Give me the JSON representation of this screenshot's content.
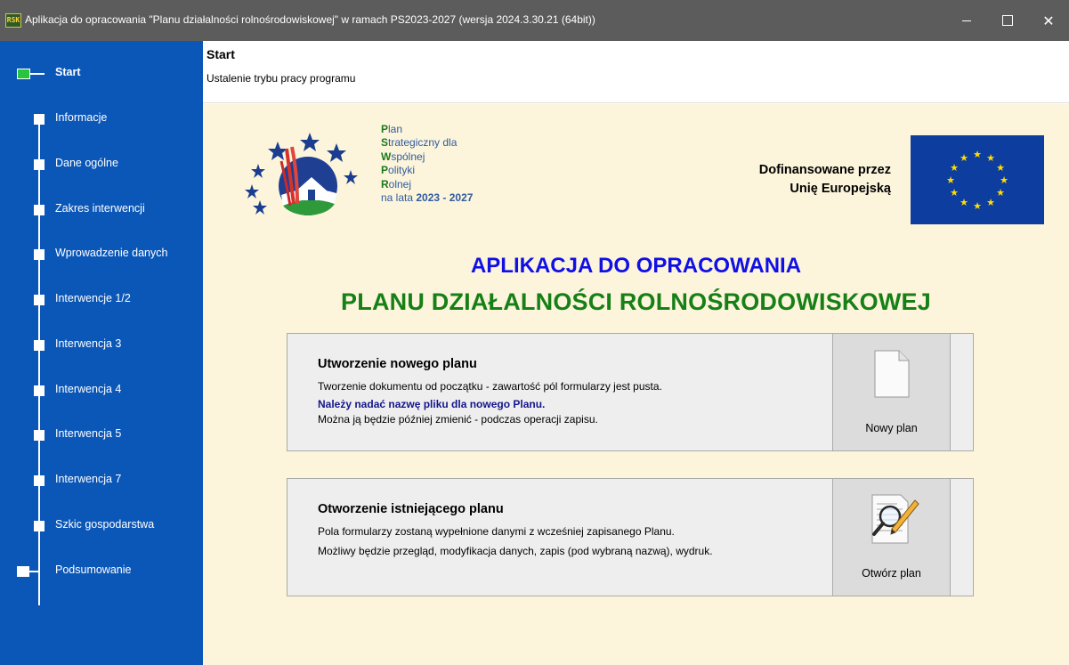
{
  "window": {
    "title": "Aplikacja do opracowania \"Planu działalności rolnośrodowiskowej\" w ramach PS2023-2027  (wersja 2024.3.30.21 (64bit))",
    "icon_text": "RSK",
    "close_glyph": "✕"
  },
  "sidebar": {
    "items": [
      {
        "label": "Start"
      },
      {
        "label": "Informacje"
      },
      {
        "label": "Dane ogólne"
      },
      {
        "label": "Zakres interwencji"
      },
      {
        "label": "Wprowadzenie danych"
      },
      {
        "label": "Interwencje 1/2"
      },
      {
        "label": "Interwencja 3"
      },
      {
        "label": "Interwencja 4"
      },
      {
        "label": "Interwencja 5"
      },
      {
        "label": "Interwencja 7"
      },
      {
        "label": "Szkic gospodarstwa"
      },
      {
        "label": "Podsumowanie"
      }
    ],
    "active_color": "#28c43c",
    "background": "#0b57b8"
  },
  "header": {
    "title": "Start",
    "subtitle": "Ustalenie trybu pracy programu"
  },
  "logo": {
    "line1_cap": "P",
    "line1_rest": "lan",
    "line2_cap": "S",
    "line2_rest": "trategiczny dla",
    "line3_cap": "W",
    "line3_rest": "spólnej",
    "line4_cap": "P",
    "line4_rest": "olityki",
    "line5_cap": "R",
    "line5_rest": "olnej",
    "line6_pre": "na lata ",
    "line6_years": "2023 - 2027"
  },
  "cofinancing": {
    "line1": "Dofinansowane przez",
    "line2": "Unię Europejską"
  },
  "main_title": {
    "line1": "APLIKACJA DO OPRACOWANIA",
    "line2": "PLANU DZIAŁALNOŚCI ROLNOŚRODOWISKOWEJ"
  },
  "new_plan": {
    "title": "Utworzenie nowego planu",
    "line1": "Tworzenie dokumentu od początku - zawartość pól formularzy jest pusta.",
    "line2": "Należy nadać nazwę pliku dla nowego Planu.",
    "line3": "Można ją będzie później zmienić - podczas operacji zapisu.",
    "button_label": "Nowy plan"
  },
  "open_plan": {
    "title": "Otworzenie istniejącego planu",
    "line1": "Pola formularzy zostaną wypełnione danymi z wcześniej zapisanego Planu.",
    "line2": "Możliwy będzie przegląd, modyfikacja danych, zapis (pod wybraną nazwą), wydruk.",
    "button_label": "Otwórz plan"
  },
  "colors": {
    "title_blue": "#1010e6",
    "title_green": "#168016",
    "main_bg": "#fcf5dc",
    "eu_blue": "#0d3d9e",
    "eu_gold": "#ffdd00"
  }
}
